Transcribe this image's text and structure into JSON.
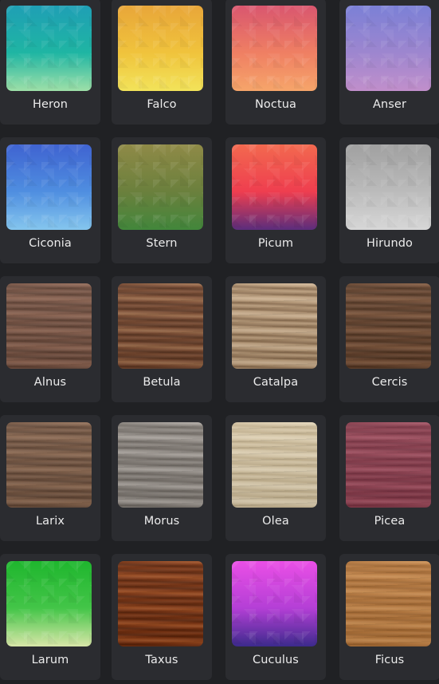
{
  "themes": [
    {
      "label": "Heron",
      "kind": "gradient",
      "colors": [
        "#1f9fb5",
        "#1fb5a3",
        "#9ee0a8"
      ]
    },
    {
      "label": "Falco",
      "kind": "gradient",
      "colors": [
        "#e8a63a",
        "#f0c33c",
        "#f2e35a"
      ]
    },
    {
      "label": "Noctua",
      "kind": "gradient",
      "colors": [
        "#d9566f",
        "#ef7f63",
        "#f6a56a"
      ]
    },
    {
      "label": "Anser",
      "kind": "gradient",
      "colors": [
        "#7b80d6",
        "#9d86cf",
        "#c18fcb"
      ]
    },
    {
      "label": "Ciconia",
      "kind": "gradient",
      "colors": [
        "#3f63d1",
        "#4f8ee0",
        "#85c6ee"
      ]
    },
    {
      "label": "Stern",
      "kind": "gradient",
      "colors": [
        "#8f8a47",
        "#6b803d",
        "#42863b"
      ]
    },
    {
      "label": "Picum",
      "kind": "gradient",
      "colors": [
        "#f2694f",
        "#ef3e4f",
        "#5b2d7c"
      ]
    },
    {
      "label": "Hirundo",
      "kind": "gradient",
      "colors": [
        "#a0a0a0",
        "#bbbbbb",
        "#d7d7d7"
      ]
    },
    {
      "label": "Alnus",
      "kind": "wood",
      "colors": [
        "#7a5545",
        "#5e4032",
        "#8c6350"
      ]
    },
    {
      "label": "Betula",
      "kind": "wood",
      "colors": [
        "#7a4a30",
        "#5a3420",
        "#9a6a48"
      ]
    },
    {
      "label": "Catalpa",
      "kind": "wood",
      "colors": [
        "#b89a78",
        "#8a6c4e",
        "#cdb292"
      ]
    },
    {
      "label": "Cercis",
      "kind": "wood",
      "colors": [
        "#6a4630",
        "#4e321f",
        "#7e563b"
      ]
    },
    {
      "label": "Larix",
      "kind": "wood",
      "colors": [
        "#7a5a45",
        "#5f4433",
        "#8d6a52"
      ]
    },
    {
      "label": "Morus",
      "kind": "wood",
      "colors": [
        "#8c8680",
        "#6e6862",
        "#a8a29c"
      ]
    },
    {
      "label": "Olea",
      "kind": "wood",
      "colors": [
        "#d5c5a5",
        "#c1af8c",
        "#e1d3b6"
      ]
    },
    {
      "label": "Picea",
      "kind": "wood",
      "colors": [
        "#8c3e4e",
        "#7a3242",
        "#a04e5f"
      ]
    },
    {
      "label": "Larum",
      "kind": "gradient",
      "colors": [
        "#1fb62e",
        "#43c548",
        "#d8e6a8"
      ]
    },
    {
      "label": "Taxus",
      "kind": "wood",
      "colors": [
        "#7a3210",
        "#5a2208",
        "#9a4a1e"
      ]
    },
    {
      "label": "Cuculus",
      "kind": "gradient",
      "colors": [
        "#ea4fe6",
        "#b43fd6",
        "#3c2a8c"
      ]
    },
    {
      "label": "Ficus",
      "kind": "wood",
      "colors": [
        "#b8793e",
        "#a0652e",
        "#c98c4f"
      ]
    }
  ]
}
